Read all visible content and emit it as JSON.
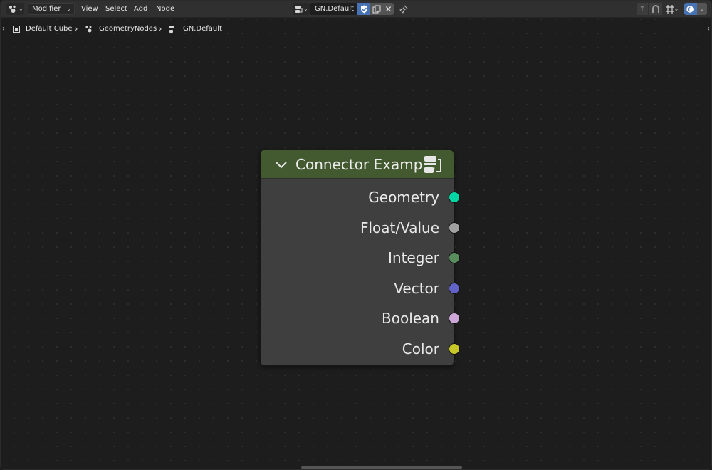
{
  "header": {
    "editor_type_icon": "node-editor-icon",
    "mode": "Modifier",
    "menus": [
      "View",
      "Select",
      "Add",
      "Node"
    ],
    "tree_name": "GN.Default"
  },
  "breadcrumb": {
    "object": "Default Cube",
    "modifier": "GeometryNodes",
    "node_group": "GN.Default"
  },
  "node": {
    "title": "Connector Examp...",
    "header_color": "#435a31",
    "sockets": [
      {
        "label": "Geometry",
        "color": "#00d6a3"
      },
      {
        "label": "Float/Value",
        "color": "#a1a1a1"
      },
      {
        "label": "Integer",
        "color": "#598c5c"
      },
      {
        "label": "Vector",
        "color": "#6363c7"
      },
      {
        "label": "Boolean",
        "color": "#cca6d6"
      },
      {
        "label": "Color",
        "color": "#c7c729"
      }
    ]
  }
}
